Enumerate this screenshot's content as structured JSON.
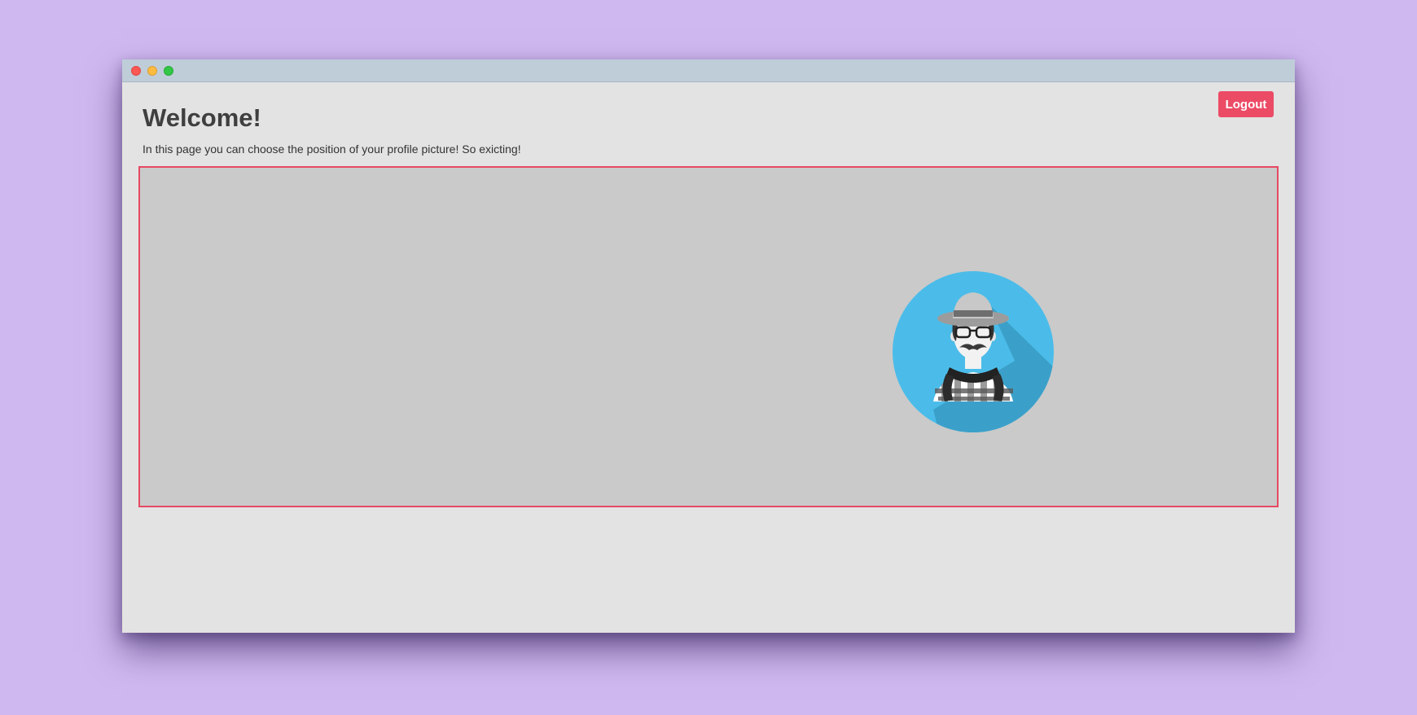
{
  "window": {
    "controls": [
      "close",
      "minimize",
      "maximize"
    ]
  },
  "header": {
    "logout_label": "Logout"
  },
  "main": {
    "title": "Welcome!",
    "description": "In this page you can choose the position of your profile picture! So exicting!"
  },
  "profile_picture": {
    "icon": "hipster-avatar-icon"
  },
  "colors": {
    "background": "#cfb8ef",
    "titlebar": "#bfcdd9",
    "window": "#e3e3e3",
    "accent": "#ec4b66",
    "picture_area": "#cacaca",
    "avatar_circle": "#4bbce9"
  }
}
